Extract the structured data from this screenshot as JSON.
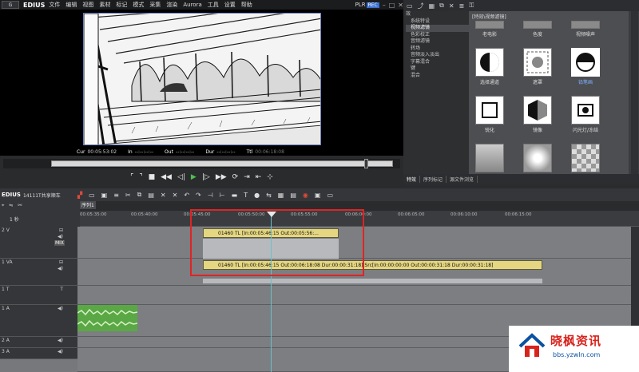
{
  "menubar": {
    "app": "EDIUS",
    "items": [
      "文件",
      "编辑",
      "视图",
      "素材",
      "标记",
      "模式",
      "采集",
      "渲染",
      "Aurora",
      "工具",
      "设置",
      "帮助"
    ],
    "plr": "PLR",
    "rec": "REC"
  },
  "preview": {
    "cur_label": "Cur",
    "cur": "00:05:53:02",
    "in_label": "In",
    "in": "--:--:--:--",
    "out_label": "Out",
    "out": "--:--:--:--",
    "dur_label": "Dur",
    "dur": "--:--:--:--",
    "ttl_label": "Ttl",
    "ttl": "00:06:18:08",
    "scrub_progress": 0.915
  },
  "effects": {
    "tree": [
      "效",
      "系统特设",
      "视频滤镜",
      "色彩校正",
      "音频滤镜",
      "转场",
      "音频淡入淡出",
      "字幕混合",
      "键",
      "混合"
    ],
    "selected_index": 2,
    "header_label": "[特效\\视频滤镜]",
    "thumbs": [
      {
        "label": "老电影"
      },
      {
        "label": "色度"
      },
      {
        "label": "视频噪声"
      },
      {
        "label": "选择通道"
      },
      {
        "label": "遮罩"
      },
      {
        "label": "铅笔画"
      },
      {
        "label": "锐化"
      },
      {
        "label": "镜像"
      },
      {
        "label": "闪光灯/冻结"
      },
      {
        "label": ""
      },
      {
        "label": ""
      },
      {
        "label": ""
      }
    ],
    "tabs": [
      "特效",
      "序列标记",
      "源文件浏览"
    ]
  },
  "timeline": {
    "app": "EDIUS",
    "project": "14111T共享顺车",
    "sequence_tab": "序列1",
    "ruler_ticks": [
      "00:05:35:00",
      "00:05:40:00",
      "00:05:45:00",
      "00:05:50:00",
      "00:05:55:00",
      "00:06:00:00",
      "00:06:05:00",
      "00:06:10:00",
      "00:06:15:00"
    ],
    "tracks": [
      {
        "name": "2 V",
        "sub": "",
        "icon": "MIX"
      },
      {
        "name": "1 VA",
        "sub": "",
        "icon": ""
      },
      {
        "name": "1 T",
        "sub": "",
        "icon": "T"
      },
      {
        "name": "1 A",
        "sub": "",
        "icon": ""
      },
      {
        "name": "2 A",
        "sub": "",
        "icon": ""
      },
      {
        "name": "3 A",
        "sub": "",
        "icon": ""
      }
    ],
    "clip_2v": "01460  TL [In:00:05:46:15 Out:00:05:56:...",
    "clip_1va": "01460  TL [In:00:05:46:15 Out:00:06:18:08 Dur:00:00:31:18]  Src[In:00:00:00:00 Out:00:00:31:18 Dur:00:00:31:18]",
    "scale_label": "1 秒"
  },
  "watermark": {
    "title": "晓枫资讯",
    "url": "bbs.yzwln.com"
  },
  "colors": {
    "clip": "#e5d681",
    "playhead": "#6ac0c8",
    "highlight": "#e02424"
  }
}
